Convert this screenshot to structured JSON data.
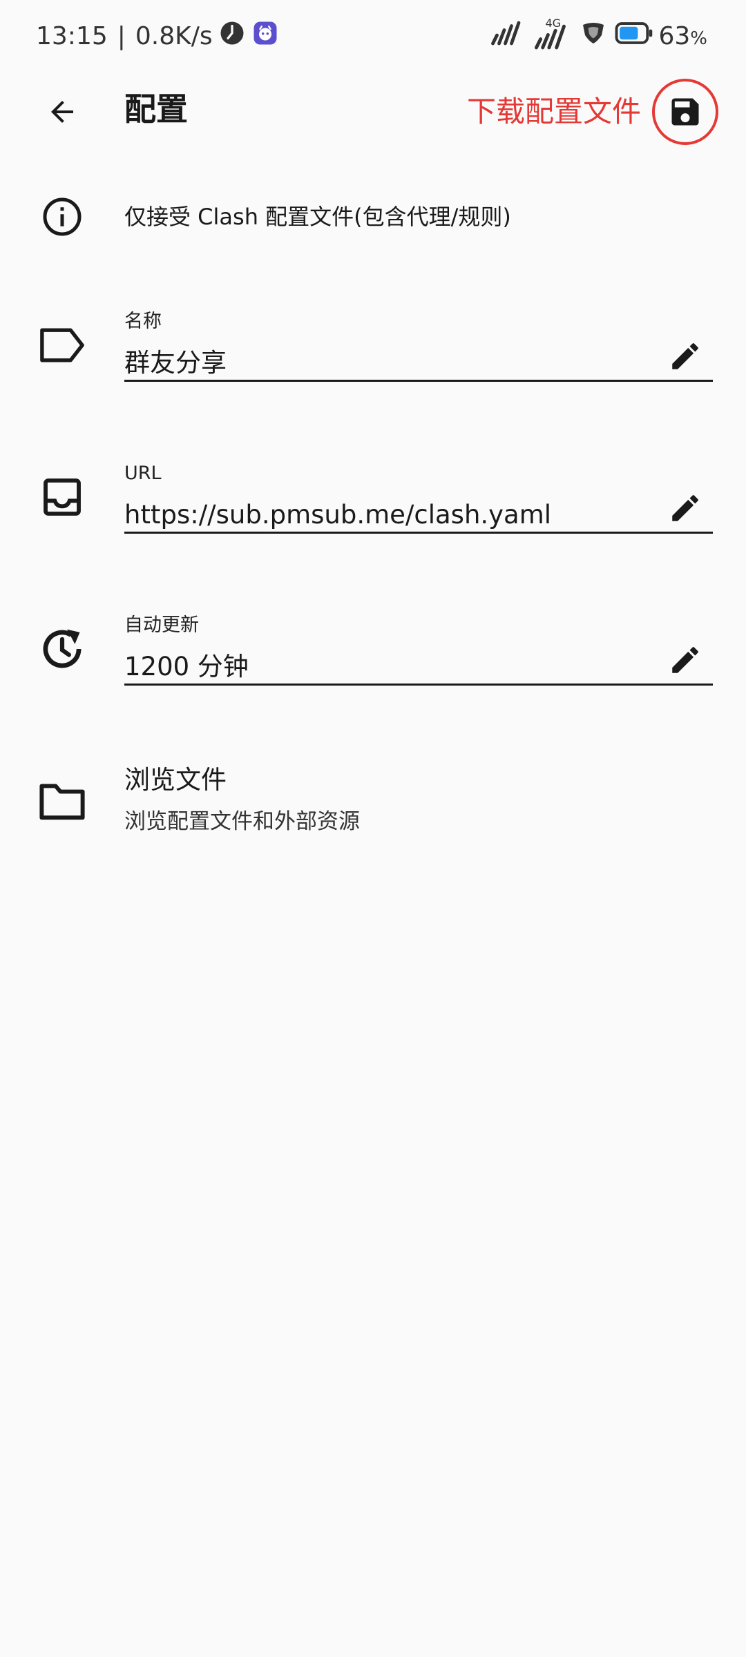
{
  "status_bar": {
    "time": "13:15",
    "separator": "|",
    "net_speed": "0.8K/s",
    "network_label": "4G",
    "battery": "63",
    "battery_unit": "%"
  },
  "app_bar": {
    "title": "配置",
    "annotation": "下载配置文件",
    "accent_color": "#e53935"
  },
  "info": {
    "text": "仅接受 Clash 配置文件(包含代理/规则)"
  },
  "fields": {
    "name": {
      "label": "名称",
      "value": "群友分享"
    },
    "url": {
      "label": "URL",
      "value": "https://sub.pmsub.me/clash.yaml"
    },
    "auto_update": {
      "label": "自动更新",
      "value": "1200 分钟"
    }
  },
  "browse": {
    "title": "浏览文件",
    "subtitle": "浏览配置文件和外部资源"
  },
  "icons": {
    "back": "arrow-back-icon",
    "save": "save-icon",
    "info": "info-icon",
    "label": "label-tag-icon",
    "inbox": "inbox-icon",
    "update": "update-clock-icon",
    "edit": "pencil-icon",
    "folder": "folder-icon"
  }
}
